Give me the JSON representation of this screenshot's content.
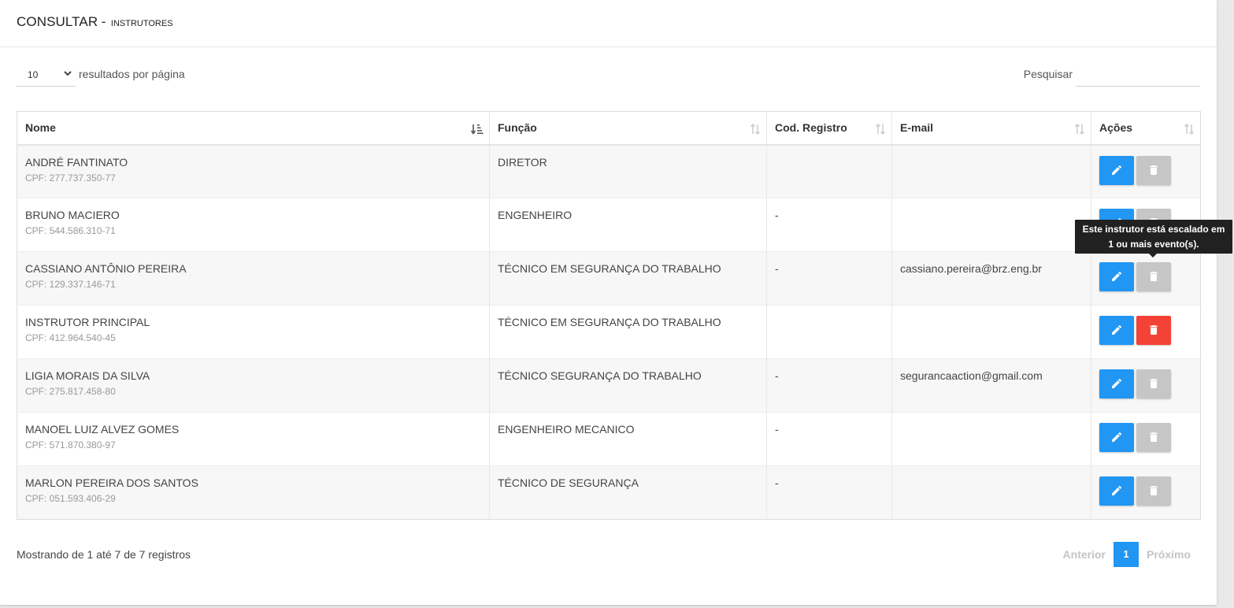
{
  "header": {
    "title": "CONSULTAR",
    "separator": "-",
    "subtitle": "INSTRUTORES"
  },
  "toolbar": {
    "page_length": "10",
    "page_length_label": "resultados por página",
    "search_label": "Pesquisar",
    "search_value": ""
  },
  "table": {
    "columns": [
      "Nome",
      "Função",
      "Cod. Registro",
      "E-mail",
      "Ações"
    ],
    "rows": [
      {
        "name": "ANDRÉ FANTINATO",
        "cpf": "CPF: 277.737.350-77",
        "funcao": "DIRETOR",
        "cod": "",
        "email": "",
        "delete_enabled": false
      },
      {
        "name": "BRUNO MACIERO",
        "cpf": "CPF: 544.586.310-71",
        "funcao": "ENGENHEIRO",
        "cod": "-",
        "email": "",
        "delete_enabled": false
      },
      {
        "name": "CASSIANO ANTÔNIO PEREIRA",
        "cpf": "CPF: 129.337.146-71",
        "funcao": "TÉCNICO EM SEGURANÇA DO TRABALHO",
        "cod": "-",
        "email": "cassiano.pereira@brz.eng.br",
        "delete_enabled": false
      },
      {
        "name": "INSTRUTOR PRINCIPAL",
        "cpf": "CPF: 412.964.540-45",
        "funcao": "TÉCNICO EM SEGURANÇA DO TRABALHO",
        "cod": "",
        "email": "",
        "delete_enabled": true
      },
      {
        "name": "LIGIA MORAIS DA SILVA",
        "cpf": "CPF: 275.817.458-80",
        "funcao": "TÉCNICO SEGURANÇA DO TRABALHO",
        "cod": "-",
        "email": "segurancaaction@gmail.com",
        "delete_enabled": false
      },
      {
        "name": "MANOEL LUIZ ALVEZ GOMES",
        "cpf": "CPF: 571.870.380-97",
        "funcao": "ENGENHEIRO MECANICO",
        "cod": "-",
        "email": "",
        "delete_enabled": false
      },
      {
        "name": "MARLON PEREIRA DOS SANTOS",
        "cpf": "CPF: 051.593.406-29",
        "funcao": "TÉCNICO DE SEGURANÇA",
        "cod": "-",
        "email": "",
        "delete_enabled": false
      }
    ]
  },
  "tooltip": {
    "line1": "Este instrutor está escalado em",
    "line2": "1 ou mais evento(s)."
  },
  "footer": {
    "info": "Mostrando de 1 até 7 de 7 registros",
    "prev_label": "Anterior",
    "current_page": "1",
    "next_label": "Próximo"
  },
  "colors": {
    "primary": "#2196f3",
    "delete_active": "#f44336",
    "delete_disabled": "#c6c6c6",
    "tooltip_bg": "#212121"
  },
  "icons": {
    "edit": "pencil-icon",
    "delete": "trash-icon",
    "sort_active": "sort-alpha-asc-icon",
    "sort": "sort-both-icon",
    "dropdown": "chevron-down-icon"
  }
}
